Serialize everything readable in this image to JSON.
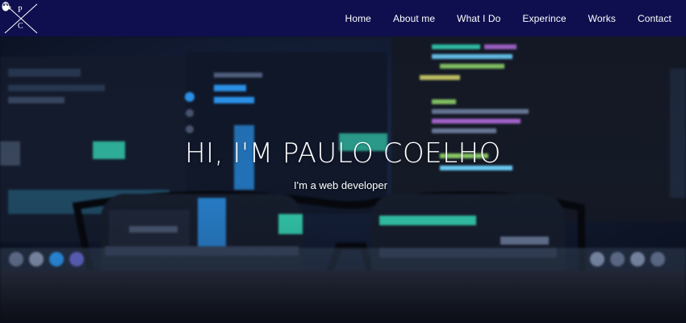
{
  "logo": {
    "letters": [
      "P",
      "C"
    ]
  },
  "nav": {
    "items": [
      {
        "label": "Home"
      },
      {
        "label": "About me"
      },
      {
        "label": "What I Do"
      },
      {
        "label": "Experince"
      },
      {
        "label": "Works"
      },
      {
        "label": "Contact"
      }
    ]
  },
  "hero": {
    "title": "HI, I'M PAULO COELHO",
    "subtitle": "I'm a web developer"
  },
  "colors": {
    "navbar_bg": "#0f0f4f",
    "text": "#ffffff",
    "accent_teal": "#35d3b4",
    "accent_blue": "#2ea0ff"
  }
}
